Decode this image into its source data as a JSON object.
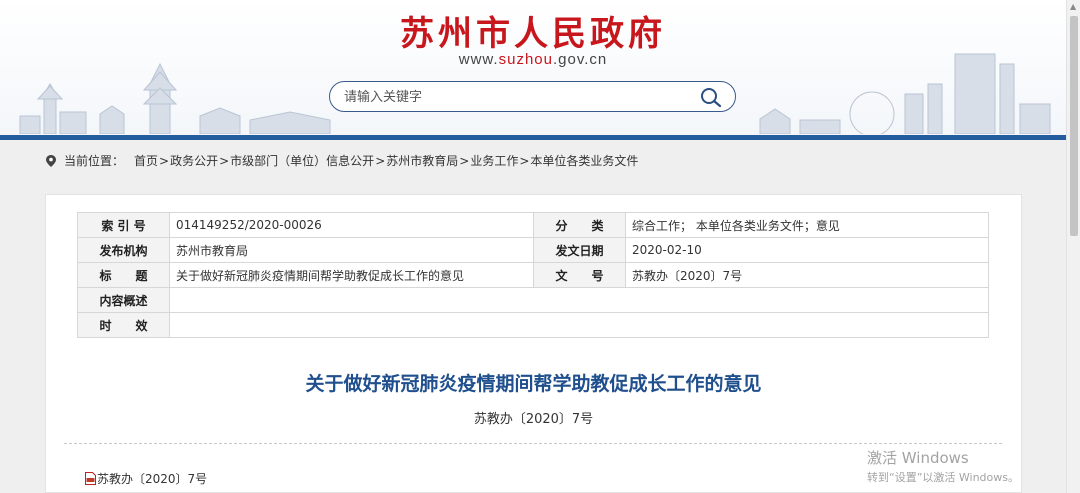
{
  "header": {
    "title": "苏州市人民政府",
    "url_prefix": "www.",
    "url_domain": "suzhou",
    "url_suffix": ".gov.cn",
    "search_placeholder": "请输入关键字",
    "brand_color": "#c8161d",
    "bar_color": "#235d9e"
  },
  "breadcrumb": {
    "icon": "location-pin-icon",
    "label": "当前位置：",
    "items": [
      "首页",
      "政务公开",
      "市级部门（单位）信息公开",
      "苏州市教育局",
      "业务工作",
      "本单位各类业务文件"
    ],
    "separator": ">"
  },
  "meta": {
    "index_label": "索 引 号",
    "index_value": "014149252/2020-00026",
    "category_label": "分　　类",
    "category_value": "综合工作； 本单位各类业务文件；意见",
    "publisher_label": "发布机构",
    "publisher_value": "苏州市教育局",
    "date_label": "发文日期",
    "date_value": "2020-02-10",
    "title_label": "标　　题",
    "title_value": "关于做好新冠肺炎疫情期间帮学助教促成长工作的意见",
    "docno_label": "文　　号",
    "docno_value": "苏教办〔2020〕7号",
    "summary_label": "内容概述",
    "summary_value": "",
    "validity_label": "时　　效",
    "validity_value": ""
  },
  "document": {
    "title": "关于做好新冠肺炎疫情期间帮学助教促成长工作的意见",
    "number": "苏教办〔2020〕7号",
    "attachment_icon": "pdf-icon",
    "attachment": "苏教办〔2020〕7号",
    "title_color": "#1f4f8c"
  },
  "watermark": {
    "line1": "激活 Windows",
    "line2": "转到“设置”以激活 Windows。"
  }
}
